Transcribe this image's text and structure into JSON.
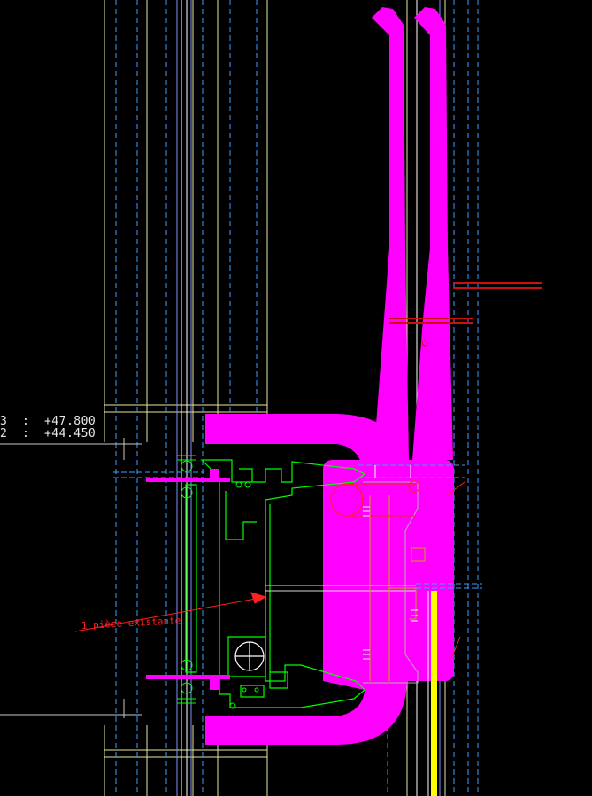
{
  "levels": [
    {
      "text": "3  :  +47.800"
    },
    {
      "text": "2  :  +44.450"
    }
  ],
  "annotation": {
    "text": "1 pièce existante"
  },
  "colors": {
    "background": "#000000",
    "magenta": "#ff00ff",
    "green": "#00ff00",
    "yellow": "#ffff00",
    "cyan": "#00bfff",
    "red": "#ff2020",
    "white": "#ffffff",
    "grey": "#b0b0b0",
    "dark_red": "#cc1010"
  }
}
